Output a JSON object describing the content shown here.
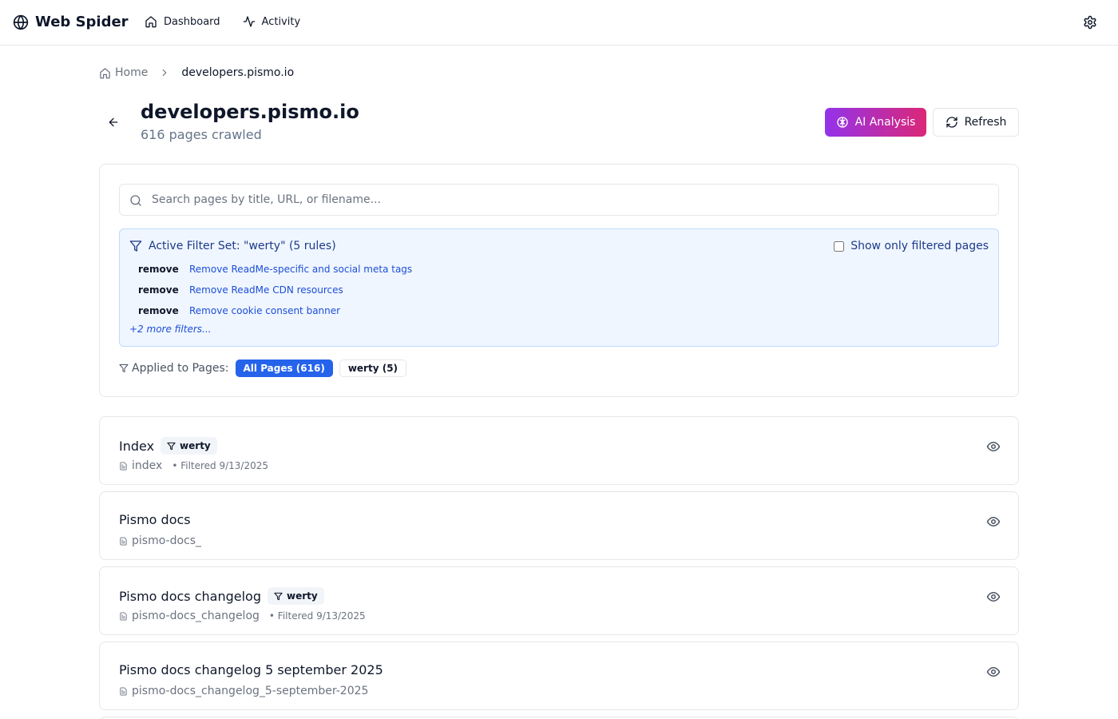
{
  "app": {
    "brand": "Web Spider",
    "nav": [
      {
        "label": "Dashboard",
        "icon": "home-icon"
      },
      {
        "label": "Activity",
        "icon": "activity-icon"
      }
    ]
  },
  "breadcrumb": {
    "home": "Home",
    "current": "developers.pismo.io"
  },
  "header": {
    "title": "developers.pismo.io",
    "subtitle": "616 pages crawled",
    "ai_button": "AI Analysis",
    "refresh_button": "Refresh"
  },
  "search": {
    "placeholder": "Search pages by title, URL, or filename...",
    "value": ""
  },
  "filter_set": {
    "heading": "Active Filter Set: \"werty\" (5 rules)",
    "show_only_label": "Show only filtered pages",
    "show_only_checked": false,
    "rules": [
      {
        "action": "remove",
        "description": "Remove ReadMe-specific and social meta tags"
      },
      {
        "action": "remove",
        "description": "Remove ReadMe CDN resources"
      },
      {
        "action": "remove",
        "description": "Remove cookie consent banner"
      }
    ],
    "more": "+2 more filters..."
  },
  "applied": {
    "label": "Applied to Pages:",
    "pills": [
      {
        "label": "All Pages (616)",
        "active": true
      },
      {
        "label": "werty (5)",
        "active": false
      }
    ]
  },
  "pages": [
    {
      "title": "Index",
      "tag": "werty",
      "filename": "index",
      "filtered": "• Filtered 9/13/2025"
    },
    {
      "title": "Pismo docs",
      "tag": null,
      "filename": "pismo-docs_",
      "filtered": null
    },
    {
      "title": "Pismo docs changelog",
      "tag": "werty",
      "filename": "pismo-docs_changelog",
      "filtered": "• Filtered 9/13/2025"
    },
    {
      "title": "Pismo docs changelog 5 september 2025",
      "tag": null,
      "filename": "pismo-docs_changelog_5-september-2025",
      "filtered": null
    }
  ],
  "colors": {
    "primary": "#2563eb",
    "ai_gradient_start": "#9333ea",
    "ai_gradient_end": "#db2777",
    "filter_bg": "#eff6ff",
    "filter_border": "#bfdbfe",
    "filter_text": "#1e3a8a",
    "muted_text": "#6b7280"
  }
}
